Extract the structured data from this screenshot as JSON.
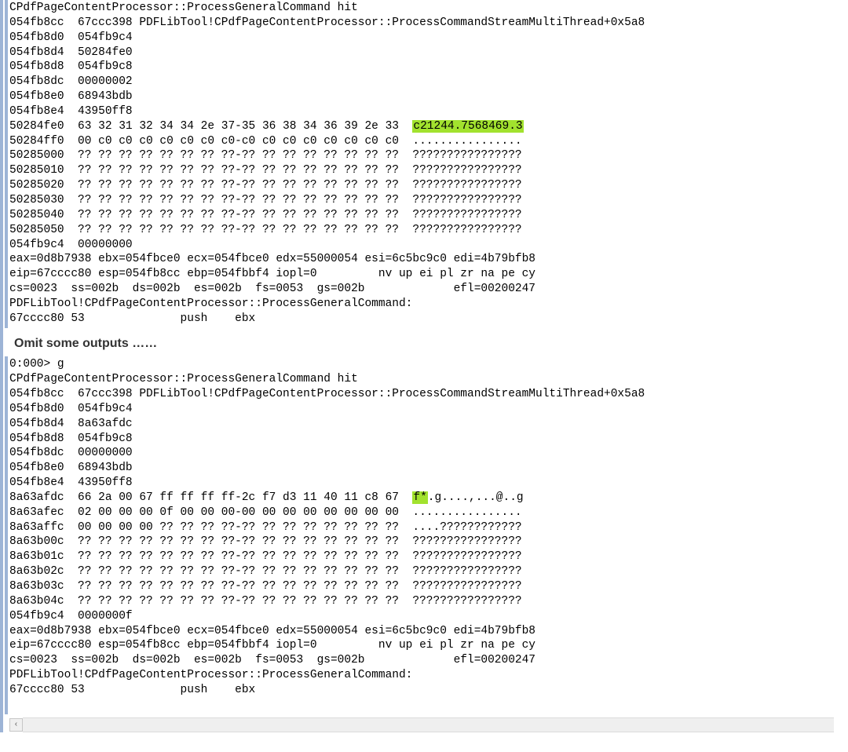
{
  "pane1": {
    "lines": [
      "CPdfPageContentProcessor::ProcessGeneralCommand hit",
      "054fb8cc  67ccc398 PDFLibTool!CPdfPageContentProcessor::ProcessCommandStreamMultiThread+0x5a8",
      "054fb8d0  054fb9c4",
      "054fb8d4  50284fe0",
      "054fb8d8  054fb9c8",
      "054fb8dc  00000002",
      "054fb8e0  68943bdb",
      "054fb8e4  43950ff8",
      "50284fe0  63 32 31 32 34 34 2e 37-35 36 38 34 36 39 2e 33  ",
      "50284ff0  00 c0 c0 c0 c0 c0 c0 c0-c0 c0 c0 c0 c0 c0 c0 c0  ................",
      "50285000  ?? ?? ?? ?? ?? ?? ?? ??-?? ?? ?? ?? ?? ?? ?? ??  ????????????????",
      "50285010  ?? ?? ?? ?? ?? ?? ?? ??-?? ?? ?? ?? ?? ?? ?? ??  ????????????????",
      "50285020  ?? ?? ?? ?? ?? ?? ?? ??-?? ?? ?? ?? ?? ?? ?? ??  ????????????????",
      "50285030  ?? ?? ?? ?? ?? ?? ?? ??-?? ?? ?? ?? ?? ?? ?? ??  ????????????????",
      "50285040  ?? ?? ?? ?? ?? ?? ?? ??-?? ?? ?? ?? ?? ?? ?? ??  ????????????????",
      "50285050  ?? ?? ?? ?? ?? ?? ?? ??-?? ?? ?? ?? ?? ?? ?? ??  ????????????????",
      "054fb9c4  00000000",
      "eax=0d8b7938 ebx=054fbce0 ecx=054fbce0 edx=55000054 esi=6c5bc9c0 edi=4b79bfb8",
      "eip=67cccc80 esp=054fb8cc ebp=054fbbf4 iopl=0         nv up ei pl zr na pe cy",
      "cs=0023  ss=002b  ds=002b  es=002b  fs=0053  gs=002b             efl=00200247",
      "PDFLibTool!CPdfPageContentProcessor::ProcessGeneralCommand:",
      "67cccc80 53              push    ebx"
    ],
    "hl_line_index": 8,
    "hl_text": "c21244.7568469.3"
  },
  "omit_note": "Omit some outputs ……",
  "pane2": {
    "lines_before": [
      "0:000> g",
      "CPdfPageContentProcessor::ProcessGeneralCommand hit",
      "054fb8cc  67ccc398 PDFLibTool!CPdfPageContentProcessor::ProcessCommandStreamMultiThread+0x5a8",
      "054fb8d0  054fb9c4",
      "054fb8d4  8a63afdc",
      "054fb8d8  054fb9c8",
      "054fb8dc  00000000",
      "054fb8e0  68943bdb",
      "054fb8e4  43950ff8"
    ],
    "hl_prefix": "8a63afdc  66 2a 00 67 ff ff ff ff-2c f7 d3 11 40 11 c8 67  ",
    "hl_text": "f*",
    "hl_suffix": ".g....,...@..g",
    "lines_after": [
      "8a63afec  02 00 00 00 0f 00 00 00-00 00 00 00 00 00 00 00  ................",
      "8a63affc  00 00 00 00 ?? ?? ?? ??-?? ?? ?? ?? ?? ?? ?? ??  ....????????????",
      "8a63b00c  ?? ?? ?? ?? ?? ?? ?? ??-?? ?? ?? ?? ?? ?? ?? ??  ????????????????",
      "8a63b01c  ?? ?? ?? ?? ?? ?? ?? ??-?? ?? ?? ?? ?? ?? ?? ??  ????????????????",
      "8a63b02c  ?? ?? ?? ?? ?? ?? ?? ??-?? ?? ?? ?? ?? ?? ?? ??  ????????????????",
      "8a63b03c  ?? ?? ?? ?? ?? ?? ?? ??-?? ?? ?? ?? ?? ?? ?? ??  ????????????????",
      "8a63b04c  ?? ?? ?? ?? ?? ?? ?? ??-?? ?? ?? ?? ?? ?? ?? ??  ????????????????",
      "054fb9c4  0000000f",
      "eax=0d8b7938 ebx=054fbce0 ecx=054fbce0 edx=55000054 esi=6c5bc9c0 edi=4b79bfb8",
      "eip=67cccc80 esp=054fb8cc ebp=054fbbf4 iopl=0         nv up ei pl zr na pe cy",
      "cs=0023  ss=002b  ds=002b  es=002b  fs=0053  gs=002b             efl=00200247",
      "PDFLibTool!CPdfPageContentProcessor::ProcessGeneralCommand:",
      "67cccc80 53              push    ebx",
      ""
    ]
  },
  "scroll": {
    "left_glyph": "‹",
    "right_glyph": "›"
  }
}
